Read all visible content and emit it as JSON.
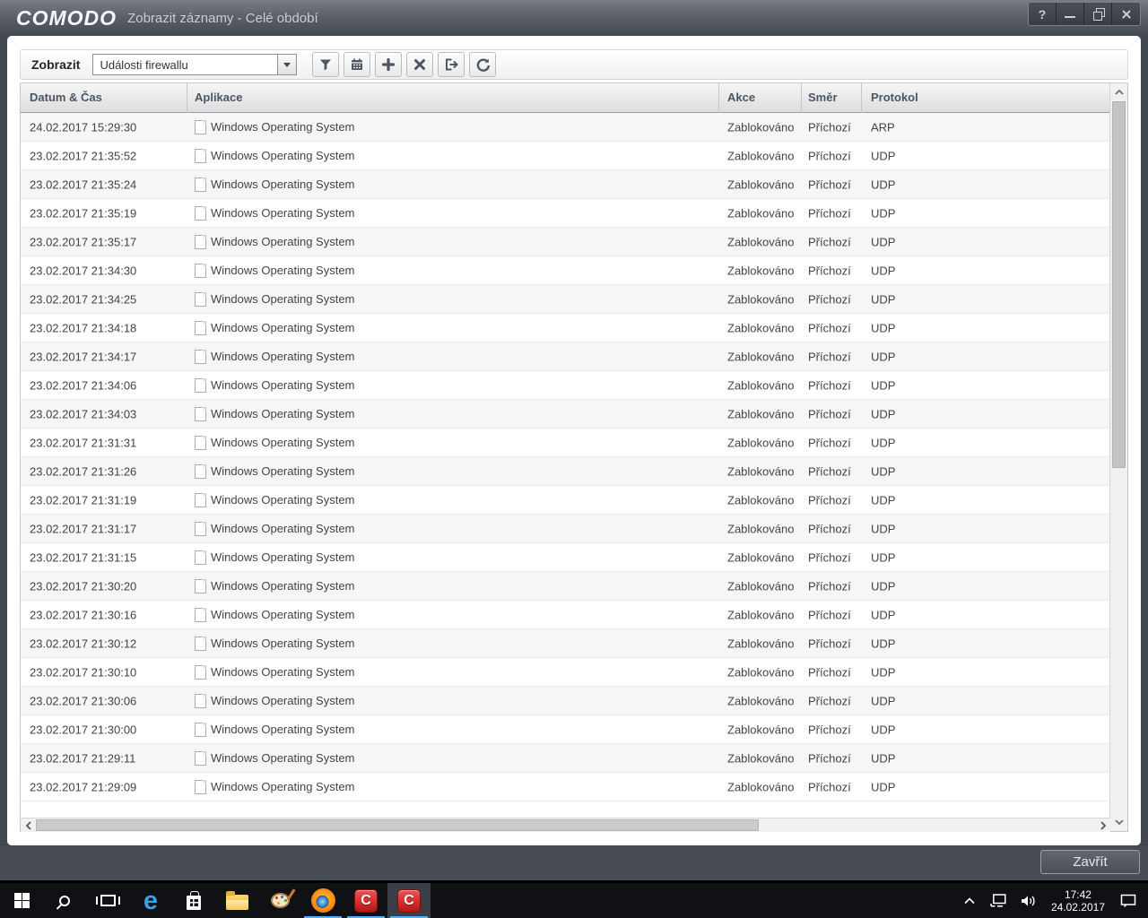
{
  "window": {
    "brand": "COMODO",
    "title": "Zobrazit záznamy - Celé období",
    "controls": {
      "help_glyph": "?",
      "icons": [
        "help-icon",
        "minimize-icon",
        "restore-icon",
        "close-icon"
      ]
    }
  },
  "toolbar": {
    "label": "Zobrazit",
    "dropdown_value": "Události firewallu",
    "buttons": [
      "filter-icon",
      "calendar-icon",
      "add-icon",
      "delete-icon",
      "export-icon",
      "refresh-icon"
    ]
  },
  "table": {
    "columns": [
      "Datum & Čas",
      "Aplikace",
      "Akce",
      "Směr",
      "Protokol"
    ],
    "rows": [
      {
        "datetime": "24.02.2017 15:29:30",
        "application": "Windows Operating System",
        "action": "Zablokováno",
        "direction": "Příchozí",
        "protocol": "ARP"
      },
      {
        "datetime": "23.02.2017 21:35:52",
        "application": "Windows Operating System",
        "action": "Zablokováno",
        "direction": "Příchozí",
        "protocol": "UDP"
      },
      {
        "datetime": "23.02.2017 21:35:24",
        "application": "Windows Operating System",
        "action": "Zablokováno",
        "direction": "Příchozí",
        "protocol": "UDP"
      },
      {
        "datetime": "23.02.2017 21:35:19",
        "application": "Windows Operating System",
        "action": "Zablokováno",
        "direction": "Příchozí",
        "protocol": "UDP"
      },
      {
        "datetime": "23.02.2017 21:35:17",
        "application": "Windows Operating System",
        "action": "Zablokováno",
        "direction": "Příchozí",
        "protocol": "UDP"
      },
      {
        "datetime": "23.02.2017 21:34:30",
        "application": "Windows Operating System",
        "action": "Zablokováno",
        "direction": "Příchozí",
        "protocol": "UDP"
      },
      {
        "datetime": "23.02.2017 21:34:25",
        "application": "Windows Operating System",
        "action": "Zablokováno",
        "direction": "Příchozí",
        "protocol": "UDP"
      },
      {
        "datetime": "23.02.2017 21:34:18",
        "application": "Windows Operating System",
        "action": "Zablokováno",
        "direction": "Příchozí",
        "protocol": "UDP"
      },
      {
        "datetime": "23.02.2017 21:34:17",
        "application": "Windows Operating System",
        "action": "Zablokováno",
        "direction": "Příchozí",
        "protocol": "UDP"
      },
      {
        "datetime": "23.02.2017 21:34:06",
        "application": "Windows Operating System",
        "action": "Zablokováno",
        "direction": "Příchozí",
        "protocol": "UDP"
      },
      {
        "datetime": "23.02.2017 21:34:03",
        "application": "Windows Operating System",
        "action": "Zablokováno",
        "direction": "Příchozí",
        "protocol": "UDP"
      },
      {
        "datetime": "23.02.2017 21:31:31",
        "application": "Windows Operating System",
        "action": "Zablokováno",
        "direction": "Příchozí",
        "protocol": "UDP"
      },
      {
        "datetime": "23.02.2017 21:31:26",
        "application": "Windows Operating System",
        "action": "Zablokováno",
        "direction": "Příchozí",
        "protocol": "UDP"
      },
      {
        "datetime": "23.02.2017 21:31:19",
        "application": "Windows Operating System",
        "action": "Zablokováno",
        "direction": "Příchozí",
        "protocol": "UDP"
      },
      {
        "datetime": "23.02.2017 21:31:17",
        "application": "Windows Operating System",
        "action": "Zablokováno",
        "direction": "Příchozí",
        "protocol": "UDP"
      },
      {
        "datetime": "23.02.2017 21:31:15",
        "application": "Windows Operating System",
        "action": "Zablokováno",
        "direction": "Příchozí",
        "protocol": "UDP"
      },
      {
        "datetime": "23.02.2017 21:30:20",
        "application": "Windows Operating System",
        "action": "Zablokováno",
        "direction": "Příchozí",
        "protocol": "UDP"
      },
      {
        "datetime": "23.02.2017 21:30:16",
        "application": "Windows Operating System",
        "action": "Zablokováno",
        "direction": "Příchozí",
        "protocol": "UDP"
      },
      {
        "datetime": "23.02.2017 21:30:12",
        "application": "Windows Operating System",
        "action": "Zablokováno",
        "direction": "Příchozí",
        "protocol": "UDP"
      },
      {
        "datetime": "23.02.2017 21:30:10",
        "application": "Windows Operating System",
        "action": "Zablokováno",
        "direction": "Příchozí",
        "protocol": "UDP"
      },
      {
        "datetime": "23.02.2017 21:30:06",
        "application": "Windows Operating System",
        "action": "Zablokováno",
        "direction": "Příchozí",
        "protocol": "UDP"
      },
      {
        "datetime": "23.02.2017 21:30:00",
        "application": "Windows Operating System",
        "action": "Zablokováno",
        "direction": "Příchozí",
        "protocol": "UDP"
      },
      {
        "datetime": "23.02.2017 21:29:11",
        "application": "Windows Operating System",
        "action": "Zablokováno",
        "direction": "Příchozí",
        "protocol": "UDP"
      },
      {
        "datetime": "23.02.2017 21:29:09",
        "application": "Windows Operating System",
        "action": "Zablokováno",
        "direction": "Příchozí",
        "protocol": "UDP"
      }
    ]
  },
  "footer": {
    "close_label": "Zavřít"
  },
  "taskbar": {
    "edge_glyph": "e",
    "comodo_glyph": "C",
    "clock": {
      "time": "17:42",
      "date": "24.02.2017"
    },
    "icons": [
      "start-icon",
      "search-icon",
      "task-view-icon",
      "edge-icon",
      "store-icon",
      "file-explorer-icon",
      "paint-icon",
      "firefox-icon",
      "comodo-icon",
      "comodo-icon-active",
      "tray-chevron-icon",
      "network-icon",
      "speaker-icon",
      "action-center-icon"
    ]
  },
  "colors": {
    "accent_red": "#c01818",
    "running_indicator": "#56aef2",
    "header_text": "#4a5664",
    "titlebar": "#5b6069"
  }
}
